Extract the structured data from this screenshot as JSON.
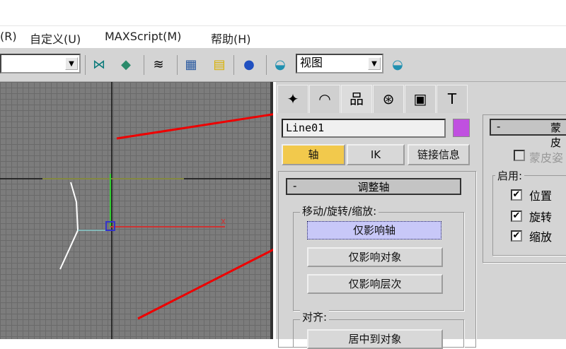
{
  "menu": [
    "(R)",
    "自定义(U)",
    "MAXScript(M)",
    "帮助(H)"
  ],
  "toolbar": {
    "view_combo": "视图",
    "icons": [
      "mirror-icon",
      "align-icon",
      "layers-icon",
      "curve-editor-icon",
      "schematic-icon",
      "material-editor-icon",
      "render-setup-icon",
      "render-icon"
    ]
  },
  "command_panel": {
    "tabs": [
      "create-tab",
      "modify-tab",
      "hierarchy-tab",
      "motion-tab",
      "display-tab",
      "utilities-tab"
    ],
    "object_name": "Line01",
    "object_color": "#c050e0",
    "sub_tabs": [
      "轴",
      "IK",
      "链接信息"
    ],
    "rollout_title": "调整轴",
    "rollout_toggle": "-",
    "group_move": "移动/旋转/缩放:",
    "buttons": [
      "仅影响轴",
      "仅影响对象",
      "仅影响层次"
    ],
    "group_align": "对齐:",
    "align_button": "居中到对象"
  },
  "right_panel": {
    "rollout_toggle": "-",
    "rollout_title": "蒙皮",
    "skin_pose": "蒙皮姿",
    "enable_label": "启用:",
    "checks": [
      "位置",
      "旋转",
      "缩放"
    ]
  },
  "viewport": {
    "axis_label": "x"
  }
}
